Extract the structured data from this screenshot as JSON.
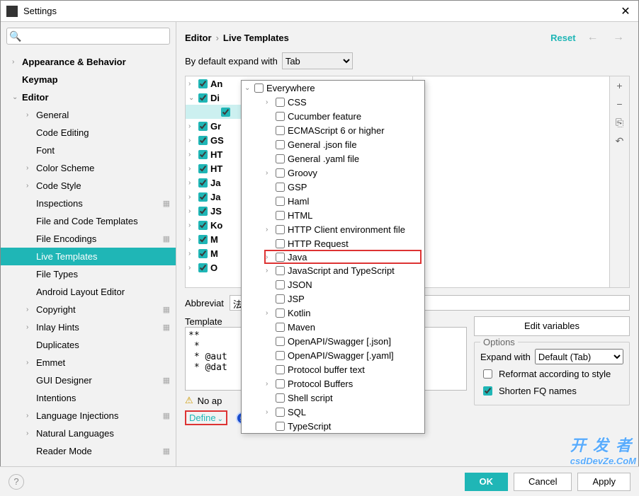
{
  "window": {
    "title": "Settings"
  },
  "search": {
    "placeholder": ""
  },
  "sidebar": {
    "items": [
      {
        "label": "Appearance & Behavior",
        "bold": true,
        "arrow": ">",
        "lvl": 0
      },
      {
        "label": "Keymap",
        "bold": true,
        "lvl": 0
      },
      {
        "label": "Editor",
        "bold": true,
        "arrow": "v",
        "lvl": 0
      },
      {
        "label": "General",
        "arrow": ">",
        "lvl": 1
      },
      {
        "label": "Code Editing",
        "lvl": 1
      },
      {
        "label": "Font",
        "lvl": 1
      },
      {
        "label": "Color Scheme",
        "arrow": ">",
        "lvl": 1
      },
      {
        "label": "Code Style",
        "arrow": ">",
        "lvl": 1
      },
      {
        "label": "Inspections",
        "gear": true,
        "lvl": 1
      },
      {
        "label": "File and Code Templates",
        "lvl": 1
      },
      {
        "label": "File Encodings",
        "gear": true,
        "lvl": 1
      },
      {
        "label": "Live Templates",
        "selected": true,
        "lvl": 1
      },
      {
        "label": "File Types",
        "lvl": 1
      },
      {
        "label": "Android Layout Editor",
        "lvl": 1
      },
      {
        "label": "Copyright",
        "arrow": ">",
        "gear": true,
        "lvl": 1
      },
      {
        "label": "Inlay Hints",
        "arrow": ">",
        "gear": true,
        "lvl": 1
      },
      {
        "label": "Duplicates",
        "lvl": 1
      },
      {
        "label": "Emmet",
        "arrow": ">",
        "lvl": 1
      },
      {
        "label": "GUI Designer",
        "gear": true,
        "lvl": 1
      },
      {
        "label": "Intentions",
        "lvl": 1
      },
      {
        "label": "Language Injections",
        "arrow": ">",
        "gear": true,
        "lvl": 1
      },
      {
        "label": "Natural Languages",
        "arrow": ">",
        "lvl": 1
      },
      {
        "label": "Reader Mode",
        "gear": true,
        "lvl": 1
      }
    ]
  },
  "breadcrumb": {
    "root": "Editor",
    "leaf": "Live Templates"
  },
  "reset_label": "Reset",
  "expand": {
    "label": "By default expand with",
    "value": "Tab"
  },
  "templates": [
    {
      "label": "An",
      "arrow": ">"
    },
    {
      "label": "Di",
      "arrow": "v"
    },
    {
      "label": "",
      "sel": true,
      "indent": true
    },
    {
      "label": "Gr",
      "arrow": ">"
    },
    {
      "label": "GS",
      "arrow": ">"
    },
    {
      "label": "HT",
      "arrow": ">"
    },
    {
      "label": "HT",
      "arrow": ">"
    },
    {
      "label": "Ja",
      "arrow": ">"
    },
    {
      "label": "Ja",
      "arrow": ">"
    },
    {
      "label": "JS",
      "arrow": ">"
    },
    {
      "label": "Ko",
      "arrow": ">"
    },
    {
      "label": "M",
      "arrow": ">"
    },
    {
      "label": "M",
      "arrow": ">"
    },
    {
      "label": "O",
      "arrow": ">"
    }
  ],
  "side_tools": [
    "+",
    "−",
    "⎘",
    "↶"
  ],
  "abbreviation_label": "Abbreviat",
  "description_value": "法注释模板",
  "template_text_label": "Template",
  "template_text": "**\n *\n * @aut\n * @dat",
  "edit_variables_label": "Edit variables",
  "options": {
    "legend": "Options",
    "expand_with_label": "Expand with",
    "expand_with_value": "Default (Tab)",
    "reformat_label": "Reformat according to style",
    "reformat_checked": false,
    "shorten_label": "Shorten FQ names",
    "shorten_checked": true
  },
  "warning": "No ap",
  "define_label": "Define",
  "step_number": "5",
  "footer": {
    "ok": "OK",
    "cancel": "Cancel",
    "apply": "Apply"
  },
  "popup": {
    "everywhere": "Everywhere",
    "items": [
      {
        "label": "CSS",
        "arrow": ">"
      },
      {
        "label": "Cucumber feature"
      },
      {
        "label": "ECMAScript 6 or higher"
      },
      {
        "label": "General .json file"
      },
      {
        "label": "General .yaml file"
      },
      {
        "label": "Groovy",
        "arrow": ">"
      },
      {
        "label": "GSP"
      },
      {
        "label": "Haml"
      },
      {
        "label": "HTML"
      },
      {
        "label": "HTTP Client environment file",
        "arrow": ">"
      },
      {
        "label": "HTTP Request"
      },
      {
        "label": "Java",
        "arrow": ">",
        "highlight": true
      },
      {
        "label": "JavaScript and TypeScript",
        "arrow": ">"
      },
      {
        "label": "JSON"
      },
      {
        "label": "JSP"
      },
      {
        "label": "Kotlin",
        "arrow": ">"
      },
      {
        "label": "Maven"
      },
      {
        "label": "OpenAPI/Swagger [.json]"
      },
      {
        "label": "OpenAPI/Swagger [.yaml]"
      },
      {
        "label": "Protocol buffer text"
      },
      {
        "label": "Protocol Buffers",
        "arrow": ">"
      },
      {
        "label": "Shell script"
      },
      {
        "label": "SQL",
        "arrow": ">"
      },
      {
        "label": "TypeScript"
      }
    ]
  },
  "watermark": {
    "cn": "开 发 者",
    "en": "csdDevZe.CoM"
  }
}
